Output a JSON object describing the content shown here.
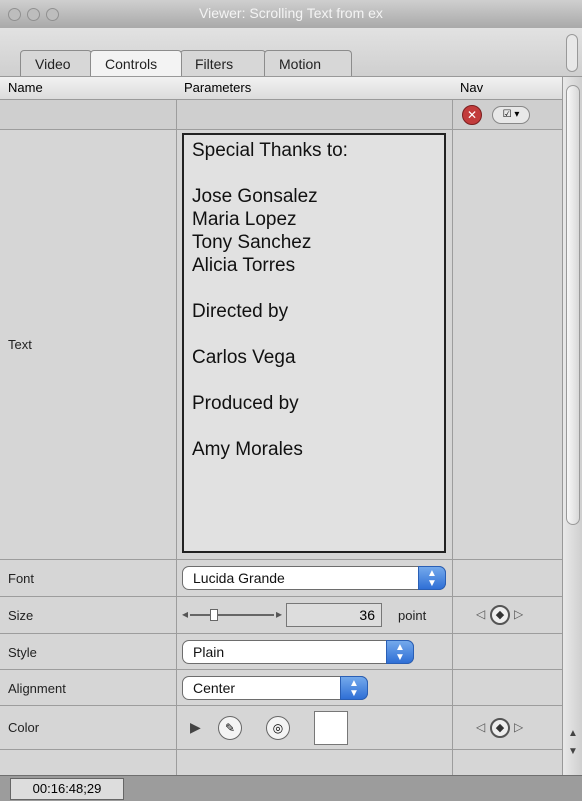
{
  "window": {
    "title": "Viewer: Scrolling Text from ex"
  },
  "tabs": [
    {
      "label": "Video"
    },
    {
      "label": "Controls"
    },
    {
      "label": "Filters"
    },
    {
      "label": "Motion"
    }
  ],
  "columns": {
    "name": "Name",
    "parameters": "Parameters",
    "nav": "Nav"
  },
  "params": {
    "text": {
      "label": "Text",
      "content": "Special Thanks to:\n\nJose Gonsalez\nMaria Lopez\nTony Sanchez\nAlicia Torres\n\nDirected by\n\nCarlos Vega\n\nProduced by\n\nAmy Morales"
    },
    "font": {
      "label": "Font",
      "value": "Lucida Grande"
    },
    "size": {
      "label": "Size",
      "value": "36",
      "unit": "point"
    },
    "style": {
      "label": "Style",
      "value": "Plain"
    },
    "alignment": {
      "label": "Alignment",
      "value": "Center"
    },
    "color": {
      "label": "Color"
    }
  },
  "status": {
    "timecode": "00:16:48;29"
  }
}
